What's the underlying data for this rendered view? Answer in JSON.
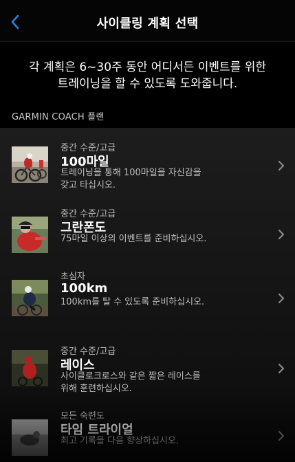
{
  "header": {
    "title": "사이클링 계획 선택"
  },
  "intro": {
    "line1": "각 계획은 6~30주 동안 어디서든 이벤트를 위한",
    "line2": "트레이닝을 할 수 있도록 도와줍니다."
  },
  "section": {
    "label": "GARMIN COACH 플랜"
  },
  "plans": [
    {
      "level": "중간 수준/고급",
      "name": "100마일",
      "desc1": "트레이닝을 통해 100마일을 자신감을",
      "desc2": "갖고 타십시오."
    },
    {
      "level": "중간 수준/고급",
      "name": "그란폰도",
      "desc1": "75마일 이상의 이벤트를 준비하십시오.",
      "desc2": ""
    },
    {
      "level": "초심자",
      "name": "100km",
      "desc1": "100km를 탈 수 있도록 준비하십시오.",
      "desc2": ""
    },
    {
      "level": "중간 수준/고급",
      "name": "레이스",
      "desc1": "사이클로크로스와 같은 짧은 레이스를",
      "desc2": "위해 훈련하십시오."
    },
    {
      "level": "모든 숙련도",
      "name": "타임 트라이얼",
      "desc1": "최고 기록을 다음 향상하십시오.",
      "desc2": ""
    }
  ],
  "colors": {
    "accent": "#2f7fe0",
    "background": "#000000",
    "secondary_text": "#bdbdbd"
  }
}
